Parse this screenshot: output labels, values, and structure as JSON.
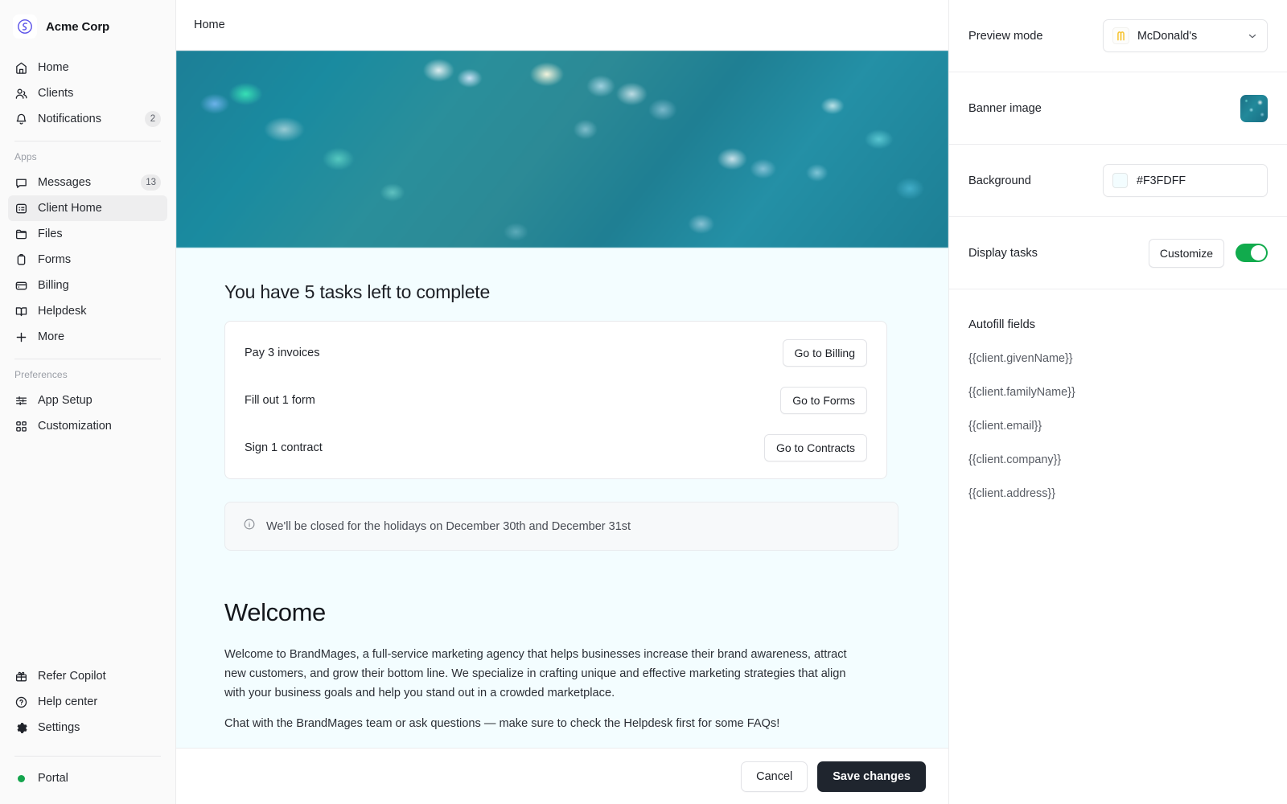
{
  "sidebar": {
    "brand": {
      "name": "Acme Corp",
      "logo_icon": "acme-logo-icon",
      "logo_color": "#5b52e8"
    },
    "primary": [
      {
        "label": "Home",
        "icon": "home-icon"
      },
      {
        "label": "Clients",
        "icon": "users-icon"
      },
      {
        "label": "Notifications",
        "icon": "bell-icon",
        "badge": "2"
      }
    ],
    "apps_heading": "Apps",
    "apps": [
      {
        "label": "Messages",
        "icon": "message-icon",
        "badge": "13"
      },
      {
        "label": "Client Home",
        "icon": "client-home-icon",
        "active": true
      },
      {
        "label": "Files",
        "icon": "folder-icon"
      },
      {
        "label": "Forms",
        "icon": "clipboard-icon"
      },
      {
        "label": "Billing",
        "icon": "credit-card-icon"
      },
      {
        "label": "Helpdesk",
        "icon": "book-icon"
      },
      {
        "label": "More",
        "icon": "plus-icon"
      }
    ],
    "preferences_heading": "Preferences",
    "preferences": [
      {
        "label": "App Setup",
        "icon": "sliders-icon"
      },
      {
        "label": "Customization",
        "icon": "grid-icon"
      }
    ],
    "bottom": [
      {
        "label": "Refer Copilot",
        "icon": "gift-icon"
      },
      {
        "label": "Help center",
        "icon": "help-circle-icon"
      },
      {
        "label": "Settings",
        "icon": "gear-icon"
      }
    ],
    "portal": {
      "label": "Portal",
      "icon": "status-dot-icon",
      "status_color": "#14a44d"
    }
  },
  "topbar": {
    "breadcrumb": "Home"
  },
  "canvas": {
    "background_color": "#F3FDFF",
    "banner": {
      "alt": "banner-image",
      "icon": "banner-bokeh-image"
    },
    "tasks_title": "You have 5 tasks left to complete",
    "tasks": [
      {
        "label": "Pay 3 invoices",
        "button": "Go to Billing"
      },
      {
        "label": "Fill out 1 form",
        "button": "Go to Forms"
      },
      {
        "label": "Sign 1 contract",
        "button": "Go to Contracts"
      }
    ],
    "notice": {
      "icon": "info-icon",
      "text": "We'll be closed for the holidays on December 30th and December 31st"
    },
    "welcome_heading": "Welcome",
    "welcome_paragraphs": [
      "Welcome to BrandMages, a full-service marketing agency that helps businesses increase their brand awareness, attract new customers, and grow their bottom line. We specialize in crafting unique and effective marketing strategies that align with your business goals and help you stand out in a crowded marketplace.",
      "Chat with the BrandMages team or ask questions — make sure to check the Helpdesk first for some FAQs!"
    ]
  },
  "actionbar": {
    "cancel_label": "Cancel",
    "save_label": "Save changes"
  },
  "rightpanel": {
    "preview_mode": {
      "label": "Preview mode",
      "selected": "McDonald's",
      "icon": "mcdonalds-icon",
      "chevron": "chevron-down-icon"
    },
    "banner_image": {
      "label": "Banner image",
      "thumbnail_icon": "banner-thumbnail-icon"
    },
    "background": {
      "label": "Background",
      "value": "#F3FDFF",
      "swatch_color": "#F3FDFF"
    },
    "display_tasks": {
      "label": "Display tasks",
      "customize_label": "Customize",
      "toggle_on": true,
      "toggle_color": "#11AB4D"
    },
    "autofill": {
      "title": "Autofill fields",
      "fields": [
        "{{client.givenName}}",
        "{{client.familyName}}",
        "{{client.email}}",
        "{{client.company}}",
        "{{client.address}}"
      ]
    }
  }
}
